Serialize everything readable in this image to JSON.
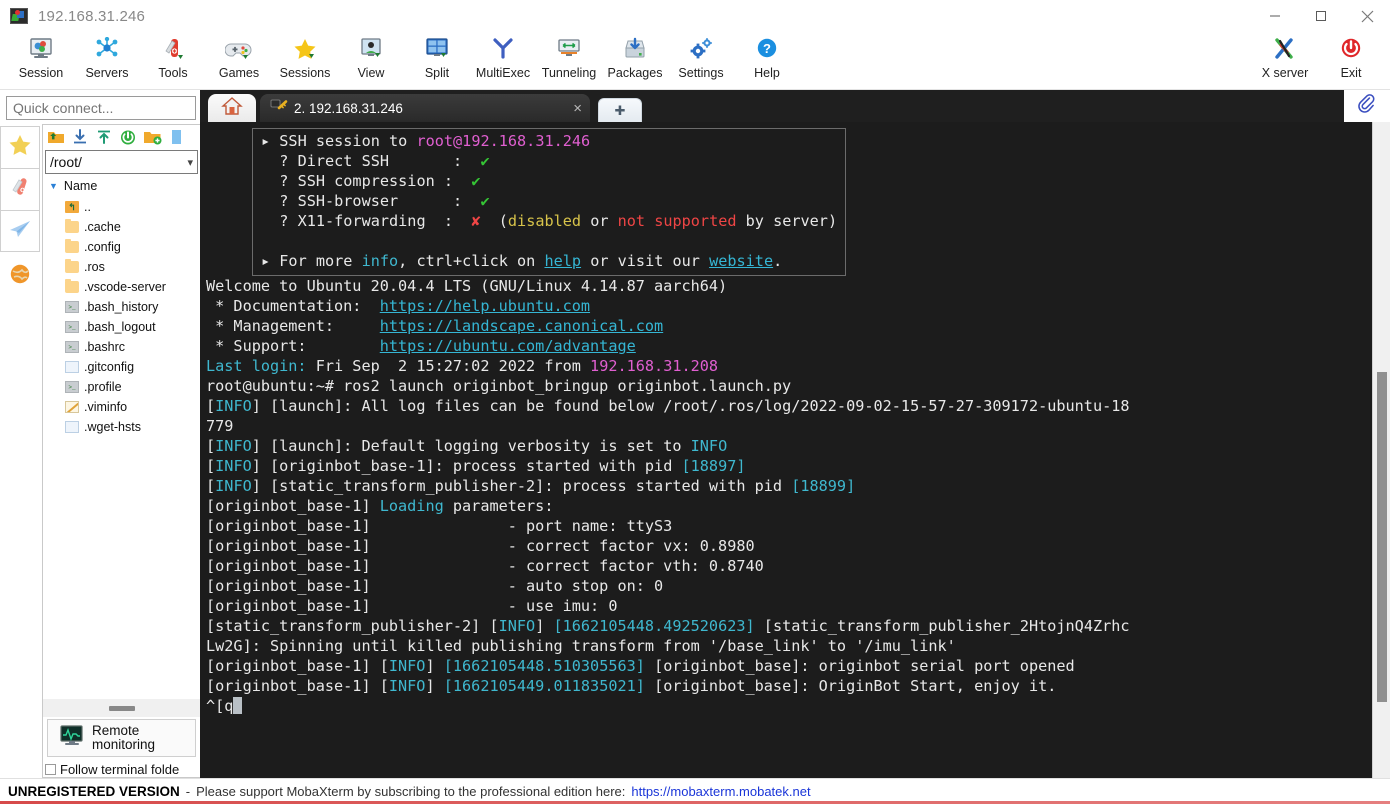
{
  "window": {
    "title": "192.168.31.246",
    "icon": "mobaxterm-logo-icon",
    "minimize": "minimize-icon",
    "maximize": "maximize-icon",
    "close": "close-icon"
  },
  "toolbar": {
    "items": [
      {
        "label": "Session",
        "icon": "session-icon"
      },
      {
        "label": "Servers",
        "icon": "servers-icon"
      },
      {
        "label": "Tools",
        "icon": "tools-icon"
      },
      {
        "label": "Games",
        "icon": "games-icon"
      },
      {
        "label": "Sessions",
        "icon": "sessions-star-icon"
      },
      {
        "label": "View",
        "icon": "view-icon"
      },
      {
        "label": "Split",
        "icon": "split-icon"
      },
      {
        "label": "MultiExec",
        "icon": "multiexec-icon"
      },
      {
        "label": "Tunneling",
        "icon": "tunneling-icon"
      },
      {
        "label": "Packages",
        "icon": "packages-icon"
      },
      {
        "label": "Settings",
        "icon": "settings-gear-icon"
      },
      {
        "label": "Help",
        "icon": "help-question-icon"
      }
    ],
    "right_items": [
      {
        "label": "X server",
        "icon": "xserver-icon"
      },
      {
        "label": "Exit",
        "icon": "exit-power-icon"
      }
    ]
  },
  "sidebar": {
    "quick_connect_placeholder": "Quick connect...",
    "rail": [
      {
        "name": "bookmarks",
        "icon": "star-icon"
      },
      {
        "name": "tools",
        "icon": "swiss-knife-icon"
      },
      {
        "name": "sftp",
        "icon": "paper-plane-icon"
      },
      {
        "name": "macros",
        "icon": "globe-icon"
      }
    ],
    "browser_toolbar": [
      {
        "name": "parent-folder",
        "icon": "up-folder-icon"
      },
      {
        "name": "download",
        "icon": "download-arrow-icon"
      },
      {
        "name": "upload",
        "icon": "upload-arrow-icon"
      },
      {
        "name": "refresh",
        "icon": "refresh-circle-icon"
      },
      {
        "name": "new-folder",
        "icon": "new-folder-icon"
      },
      {
        "name": "new-file",
        "icon": "new-file-icon"
      }
    ],
    "path": "/root/",
    "column_header": "Name",
    "files": [
      {
        "name": "..",
        "type": "up"
      },
      {
        "name": ".cache",
        "type": "folder"
      },
      {
        "name": ".config",
        "type": "folder"
      },
      {
        "name": ".ros",
        "type": "folder"
      },
      {
        "name": ".vscode-server",
        "type": "folder"
      },
      {
        "name": ".bash_history",
        "type": "script"
      },
      {
        "name": ".bash_logout",
        "type": "script"
      },
      {
        "name": ".bashrc",
        "type": "script"
      },
      {
        "name": ".gitconfig",
        "type": "plain"
      },
      {
        "name": ".profile",
        "type": "script"
      },
      {
        "name": ".viminfo",
        "type": "vim"
      },
      {
        "name": ".wget-hsts",
        "type": "plain"
      }
    ],
    "remote_monitoring_label_line1": "Remote",
    "remote_monitoring_label_line2": "monitoring",
    "follow_terminal_label": "Follow terminal folde"
  },
  "tabs": {
    "home_icon": "home-icon",
    "session_icon": "key-icon",
    "session_label": "2. 192.168.31.246",
    "close_glyph": "×",
    "new_tab_glyph": "✚",
    "clip_icon": "paperclip-icon"
  },
  "terminal": {
    "banner": {
      "line1_bullet": "▸",
      "line1_pre": " SSH session to ",
      "line1_host": "root@192.168.31.246",
      "rows": [
        {
          "q": "  ? Direct SSH       :  ",
          "mark": "✔",
          "mark_color": "green",
          "tail": ""
        },
        {
          "q": "  ? SSH compression :  ",
          "mark": "✔",
          "mark_color": "green",
          "tail": ""
        },
        {
          "q": "  ? SSH-browser      :  ",
          "mark": "✔",
          "mark_color": "green",
          "tail": ""
        },
        {
          "q": "  ? X11-forwarding  :  ",
          "mark": "✘",
          "mark_color": "red",
          "tail": ""
        }
      ],
      "x11_tail_open": "  (",
      "x11_disabled": "disabled",
      "x11_or": " or ",
      "x11_not_supported": "not supported",
      "x11_by_server": " by server)",
      "more_bullet": "▸",
      "more_pre": " For more ",
      "more_info": "info",
      "more_mid": ", ctrl+click on ",
      "more_help": "help",
      "more_mid2": " or visit our ",
      "more_website": "website",
      "more_end": "."
    },
    "welcome": "Welcome to Ubuntu 20.04.4 LTS (GNU/Linux 4.14.87 aarch64)",
    "links": [
      {
        "label": " * Documentation:  ",
        "url": "https://help.ubuntu.com"
      },
      {
        "label": " * Management:     ",
        "url": "https://landscape.canonical.com"
      },
      {
        "label": " * Support:        ",
        "url": "https://ubuntu.com/advantage"
      }
    ],
    "last_login_label": "Last login:",
    "last_login_rest": " Fri Sep  2 15:27:02 2022 from ",
    "last_login_ip": "192.168.31.208",
    "prompt": "root@ubuntu:~# ",
    "command": "ros2 launch originbot_bringup originbot.launch.py",
    "log_lines": [
      {
        "parts": [
          {
            "t": "[",
            "c": "white"
          },
          {
            "t": "INFO",
            "c": "cyan"
          },
          {
            "t": "] [launch]: All log files can be found below /root/.ros/log/2022-09-02-15-57-27-309172-ubuntu-18",
            "c": "white"
          }
        ]
      },
      {
        "parts": [
          {
            "t": "779",
            "c": "white"
          }
        ]
      },
      {
        "parts": [
          {
            "t": "[",
            "c": "white"
          },
          {
            "t": "INFO",
            "c": "cyan"
          },
          {
            "t": "] [launch]: Default logging verbosity is set to ",
            "c": "white"
          },
          {
            "t": "INFO",
            "c": "cyan"
          }
        ]
      },
      {
        "parts": [
          {
            "t": "[",
            "c": "white"
          },
          {
            "t": "INFO",
            "c": "cyan"
          },
          {
            "t": "] [originbot_base-1]: process started with pid ",
            "c": "white"
          },
          {
            "t": "[18897]",
            "c": "cyan"
          }
        ]
      },
      {
        "parts": [
          {
            "t": "[",
            "c": "white"
          },
          {
            "t": "INFO",
            "c": "cyan"
          },
          {
            "t": "] [static_transform_publisher-2]: process started with pid ",
            "c": "white"
          },
          {
            "t": "[18899]",
            "c": "cyan"
          }
        ]
      },
      {
        "parts": [
          {
            "t": "[originbot_base-1] ",
            "c": "white"
          },
          {
            "t": "Loading",
            "c": "cyan"
          },
          {
            "t": " parameters:",
            "c": "white"
          }
        ]
      },
      {
        "parts": [
          {
            "t": "[originbot_base-1]               - port name: ttyS3",
            "c": "white"
          }
        ]
      },
      {
        "parts": [
          {
            "t": "[originbot_base-1]               - correct factor vx: 0.8980",
            "c": "white"
          }
        ]
      },
      {
        "parts": [
          {
            "t": "[originbot_base-1]               - correct factor vth: 0.8740",
            "c": "white"
          }
        ]
      },
      {
        "parts": [
          {
            "t": "[originbot_base-1]               - auto stop on: 0",
            "c": "white"
          }
        ]
      },
      {
        "parts": [
          {
            "t": "[originbot_base-1]               - use imu: 0",
            "c": "white"
          }
        ]
      },
      {
        "parts": [
          {
            "t": "[static_transform_publisher-2] [",
            "c": "white"
          },
          {
            "t": "INFO",
            "c": "cyan"
          },
          {
            "t": "] ",
            "c": "white"
          },
          {
            "t": "[1662105448.492520623]",
            "c": "cyan"
          },
          {
            "t": " [static_transform_publisher_2HtojnQ4Zrhc",
            "c": "white"
          }
        ]
      },
      {
        "parts": [
          {
            "t": "Lw2G]: Spinning until killed publishing transform from '/base_link' to '/imu_link'",
            "c": "white"
          }
        ]
      },
      {
        "parts": [
          {
            "t": "[originbot_base-1] [",
            "c": "white"
          },
          {
            "t": "INFO",
            "c": "cyan"
          },
          {
            "t": "] ",
            "c": "white"
          },
          {
            "t": "[1662105448.510305563]",
            "c": "cyan"
          },
          {
            "t": " [originbot_base]: originbot serial port opened",
            "c": "white"
          }
        ]
      },
      {
        "parts": [
          {
            "t": "[originbot_base-1] [",
            "c": "white"
          },
          {
            "t": "INFO",
            "c": "cyan"
          },
          {
            "t": "] ",
            "c": "white"
          },
          {
            "t": "[1662105449.011835021]",
            "c": "cyan"
          },
          {
            "t": " [originbot_base]: OriginBot Start, enjoy it.",
            "c": "white"
          }
        ]
      },
      {
        "parts": [
          {
            "t": "^[q",
            "c": "white"
          },
          {
            "t": "CURSOR",
            "c": "cursor"
          }
        ]
      }
    ]
  },
  "statusbar": {
    "unregistered": "UNREGISTERED VERSION",
    "dash": "-",
    "message": "Please support MobaXterm by subscribing to the professional edition here:",
    "link": "https://mobaxterm.mobatek.net"
  },
  "colors": {
    "terminal_bg": "#1c1c1c",
    "cyan": "#35b6d4",
    "magenta": "#e05fd0",
    "green": "#35c535",
    "red": "#ef4545",
    "yellow": "#d7c34a",
    "accent_blue": "#2b80d6"
  }
}
